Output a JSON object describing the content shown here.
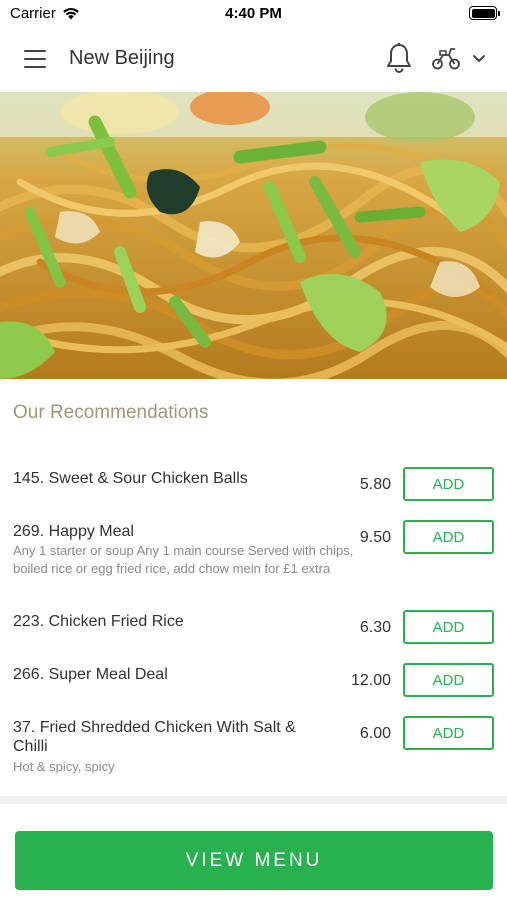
{
  "status_bar": {
    "carrier": "Carrier",
    "time": "4:40 PM"
  },
  "nav": {
    "title": "New Beijing"
  },
  "recommendations": {
    "title": "Our Recommendations",
    "add_label": "ADD",
    "items": [
      {
        "name": "145. Sweet & Sour Chicken Balls",
        "description": "",
        "price": "5.80"
      },
      {
        "name": "269. Happy Meal",
        "description": "Any 1 starter or soup  Any 1 main course  Served with chips, boiled rice or egg fried rice, add chow mein for £1 extra",
        "price": "9.50"
      },
      {
        "name": "223. Chicken Fried Rice",
        "description": "",
        "price": "6.30"
      },
      {
        "name": "266. Super Meal Deal",
        "description": "",
        "price": "12.00"
      },
      {
        "name": "37. Fried Shredded Chicken With Salt & Chilli",
        "description": "Hot & spicy, spicy",
        "price": "6.00"
      }
    ]
  },
  "footer": {
    "view_menu_label": "VIEW MENU"
  },
  "colors": {
    "accent": "#27b24f",
    "section_title": "#a3967a"
  }
}
